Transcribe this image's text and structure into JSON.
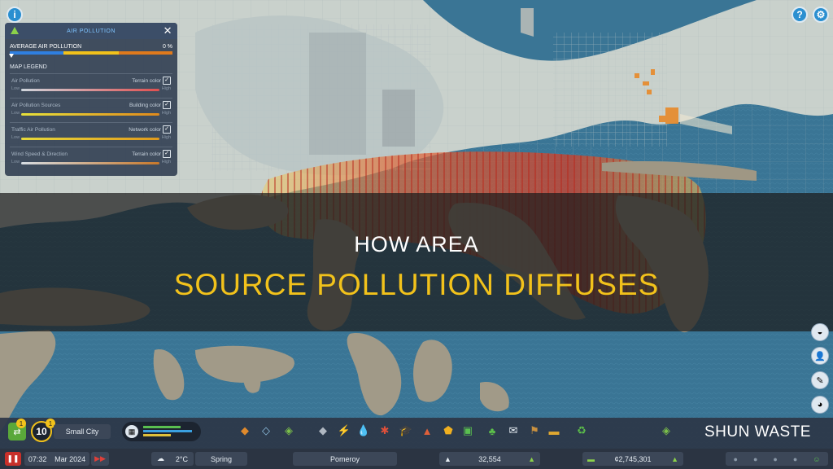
{
  "top_left_button": {
    "icon": "info-icon",
    "glyph": "i"
  },
  "top_right_buttons": [
    {
      "name": "help-button",
      "icon": "question-icon",
      "glyph": "?"
    },
    {
      "name": "settings-button",
      "icon": "gear-icon",
      "glyph": "⚙"
    }
  ],
  "panel": {
    "title": "AIR POLLUTION",
    "close_glyph": "✕",
    "average_label": "AVERAGE AIR POLLUTION",
    "average_value": "0 %",
    "average_fraction": 0.0,
    "legend_title": "MAP LEGEND",
    "legend": [
      {
        "name": "Air Pollution",
        "option": "Terrain color",
        "low": "Low",
        "high": "High",
        "colors": [
          "#cfd6dd",
          "#e05050"
        ]
      },
      {
        "name": "Air Pollution Sources",
        "option": "Building color",
        "low": "Low",
        "high": "High",
        "colors": [
          "#e7e13a",
          "#e08a1c"
        ]
      },
      {
        "name": "Traffic Air Pollution",
        "option": "Network color",
        "low": "Low",
        "high": "High",
        "colors": [
          "#e7d93a",
          "#e09a1c"
        ]
      },
      {
        "name": "Wind Speed & Direction",
        "option": "Terrain color",
        "low": "Low",
        "high": "High",
        "colors": [
          "#d7dde3",
          "#c8782a"
        ]
      }
    ],
    "check_glyph": "✓"
  },
  "banner": {
    "line1": "HOW AREA",
    "line2": "SOURCE POLLUTION DIFFUSES"
  },
  "side_tools": [
    {
      "name": "water-tool-icon",
      "glyph": "◒"
    },
    {
      "name": "citizen-icon",
      "glyph": "👤"
    },
    {
      "name": "notes-icon",
      "glyph": "✎"
    },
    {
      "name": "chart-tool-icon",
      "glyph": "◕"
    }
  ],
  "toolbar": {
    "milestone_level": "10",
    "badge_1": "1",
    "badge_2": "1",
    "city_type": "Small City",
    "tools": [
      {
        "name": "zoning-icon",
        "glyph": "◆",
        "color": "#e08a2c"
      },
      {
        "name": "area-icon",
        "glyph": "◇",
        "color": "#8fc0e0"
      },
      {
        "name": "landscaping-icon",
        "glyph": "◈",
        "color": "#7cc04a"
      },
      {
        "name": "roads-icon",
        "glyph": "◆",
        "color": "#b0b8c2"
      },
      {
        "name": "electricity-icon",
        "glyph": "⚡",
        "color": "#f5c21b"
      },
      {
        "name": "water-icon",
        "glyph": "💧",
        "color": "#3aa0e0"
      },
      {
        "name": "health-icon",
        "glyph": "✱",
        "color": "#e0503a"
      },
      {
        "name": "education-icon",
        "glyph": "🎓",
        "color": "#c8d0d8"
      },
      {
        "name": "fire-icon",
        "glyph": "▲",
        "color": "#e0603a"
      },
      {
        "name": "police-icon",
        "glyph": "⬟",
        "color": "#f0b020"
      },
      {
        "name": "transport-icon",
        "glyph": "▣",
        "color": "#5ac050"
      },
      {
        "name": "parks-icon",
        "glyph": "♣",
        "color": "#5cc04a"
      },
      {
        "name": "communication-icon",
        "glyph": "✉",
        "color": "#e8eef4"
      },
      {
        "name": "landmark-icon",
        "glyph": "⚑",
        "color": "#c89040"
      },
      {
        "name": "bulldoze-icon",
        "glyph": "▬",
        "color": "#e0a830"
      },
      {
        "name": "recycle-icon",
        "glyph": "♻",
        "color": "#5cc04a"
      },
      {
        "name": "map-layers-icon",
        "glyph": "◈",
        "color": "#7cc04a"
      }
    ]
  },
  "watermark": "SHUN WASTE",
  "status": {
    "pause_glyph": "❚❚",
    "time": "07:32",
    "date": "Mar 2024",
    "speed_glyph": "▶▶",
    "weather_icon": "cloud-icon",
    "temperature": "2°C",
    "season": "Spring",
    "city_name": "Pomeroy",
    "population": "32,554",
    "money": "¢2,745,301",
    "happiness_icon": "smiley-icon"
  }
}
